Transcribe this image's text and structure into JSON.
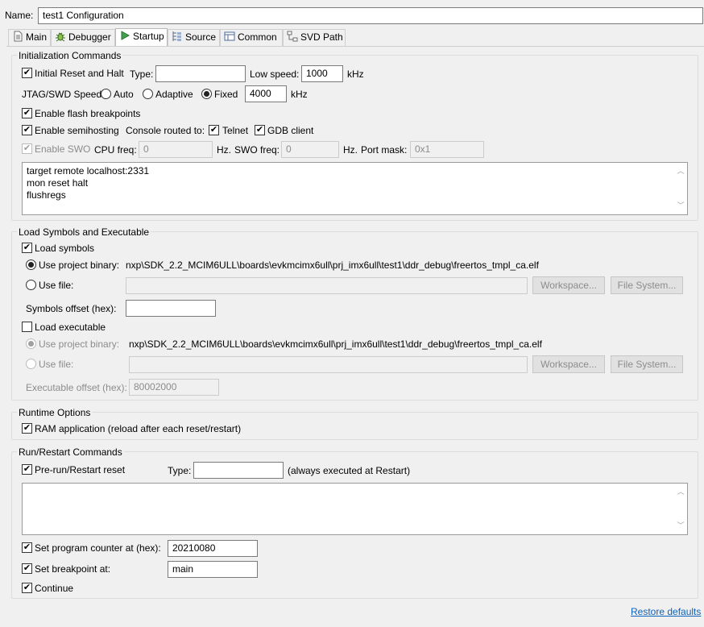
{
  "name_label": "Name:",
  "name_value": "test1 Configuration",
  "tabs": [
    {
      "label": "Main",
      "icon": "document-icon"
    },
    {
      "label": "Debugger",
      "icon": "bug-icon"
    },
    {
      "label": "Startup",
      "icon": "play-icon"
    },
    {
      "label": "Source",
      "icon": "source-icon"
    },
    {
      "label": "Common",
      "icon": "common-icon"
    },
    {
      "label": "SVD Path",
      "icon": "svd-icon"
    }
  ],
  "active_tab": "Startup",
  "init": {
    "title": "Initialization Commands",
    "initial_reset": {
      "label": "Initial Reset and Halt",
      "checked": true
    },
    "type_label": "Type:",
    "type_value": "",
    "low_speed_label": "Low speed:",
    "low_speed_value": "1000",
    "low_speed_unit": "kHz",
    "jtag_label": "JTAG/SWD Speed:",
    "speed_auto": "Auto",
    "speed_adaptive": "Adaptive",
    "speed_fixed": "Fixed",
    "speed_selected": "Fixed",
    "fixed_value": "4000",
    "fixed_unit": "kHz",
    "flash_bp": {
      "label": "Enable flash breakpoints",
      "checked": true
    },
    "semihosting": {
      "label": "Enable semihosting",
      "checked": true
    },
    "console_label": "Console routed to:",
    "telnet": {
      "label": "Telnet",
      "checked": true
    },
    "gdb_client": {
      "label": "GDB client",
      "checked": true
    },
    "swo": {
      "label": "Enable SWO",
      "checked": true,
      "enabled": false
    },
    "cpu_freq_label": "CPU freq:",
    "cpu_freq_value": "0",
    "cpu_freq_unit": "Hz.",
    "swo_freq_label": "SWO freq:",
    "swo_freq_value": "0",
    "swo_freq_unit": "Hz.",
    "port_mask_label": "Port mask:",
    "port_mask_value": "0x1",
    "commands": [
      "target remote localhost:2331",
      "mon reset halt",
      "flushregs"
    ]
  },
  "load": {
    "title": "Load Symbols and Executable",
    "load_symbols": {
      "label": "Load symbols",
      "checked": true
    },
    "use_project_binary": "Use project binary:",
    "project_binary_path": "nxp\\SDK_2.2_MCIM6ULL\\boards\\evkmcimx6ull\\prj_imx6ull\\test1\\ddr_debug\\freertos_tmpl_ca.elf",
    "use_file": "Use file:",
    "file_value": "",
    "workspace_btn": "Workspace...",
    "file_system_btn": "File System...",
    "symbols_offset_label": "Symbols offset (hex):",
    "symbols_offset_value": "",
    "load_executable": {
      "label": "Load executable",
      "checked": false
    },
    "exe_use_project_binary": "Use project binary:",
    "exe_project_binary_path": "nxp\\SDK_2.2_MCIM6ULL\\boards\\evkmcimx6ull\\prj_imx6ull\\test1\\ddr_debug\\freertos_tmpl_ca.elf",
    "exe_use_file": "Use file:",
    "exe_file_value": "",
    "exe_workspace_btn": "Workspace...",
    "exe_file_system_btn": "File System...",
    "exe_offset_label": "Executable offset (hex):",
    "exe_offset_value": "80002000"
  },
  "runtime": {
    "title": "Runtime Options",
    "ram_app": {
      "label": "RAM application (reload after each reset/restart)",
      "checked": true
    }
  },
  "run": {
    "title": "Run/Restart Commands",
    "pre_run": {
      "label": "Pre-run/Restart reset",
      "checked": true
    },
    "type_label": "Type:",
    "type_value": "",
    "always_note": "(always executed at Restart)",
    "set_pc": {
      "label": "Set program counter at (hex):",
      "checked": true
    },
    "pc_value": "20210080",
    "set_bp": {
      "label": "Set breakpoint at:",
      "checked": true
    },
    "bp_value": "main",
    "continue": {
      "label": "Continue",
      "checked": true
    }
  },
  "restore_defaults": "Restore defaults",
  "colors": {
    "link": "#0b62b8",
    "background": "#f0f0f0"
  }
}
